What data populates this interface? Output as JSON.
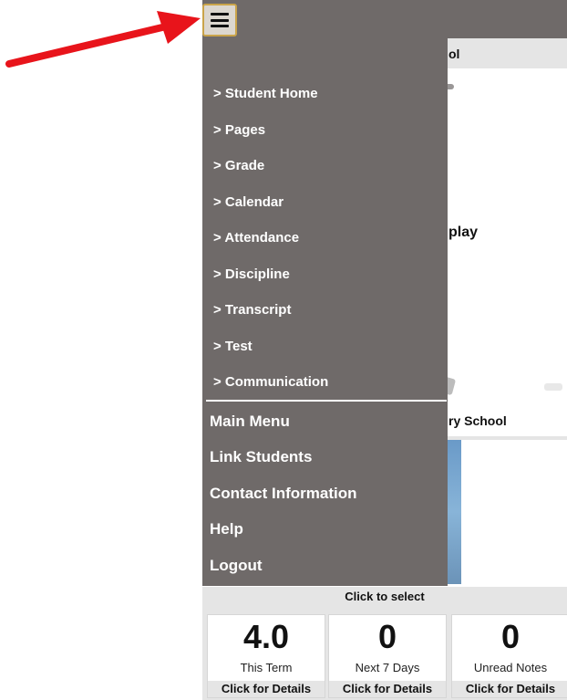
{
  "header": {
    "menu_icon": "hamburger-icon",
    "school_title_partial": "ol"
  },
  "background": {
    "display_text_partial": "play",
    "school_name_partial": "ry School"
  },
  "drawer": {
    "student_items": [
      "> Student Home",
      "> Pages",
      "> Grade",
      "> Calendar",
      "> Attendance",
      "> Discipline",
      "> Transcript",
      "> Test",
      "> Communication"
    ],
    "main_items": [
      "Main Menu",
      "Link Students",
      "Contact Information",
      "Help",
      "Logout"
    ]
  },
  "select_bar": {
    "label": "Click to select"
  },
  "cards": [
    {
      "value": "4.0",
      "label": "This Term",
      "footer": "Click for Details"
    },
    {
      "value": "0",
      "label": "Next 7 Days",
      "footer": "Click for Details"
    },
    {
      "value": "0",
      "label": "Unread Notes",
      "footer": "Click for Details"
    }
  ],
  "colors": {
    "drawer_bg": "#6f6a69",
    "annotation_arrow": "#e8141b",
    "button_border": "#caa44a"
  }
}
